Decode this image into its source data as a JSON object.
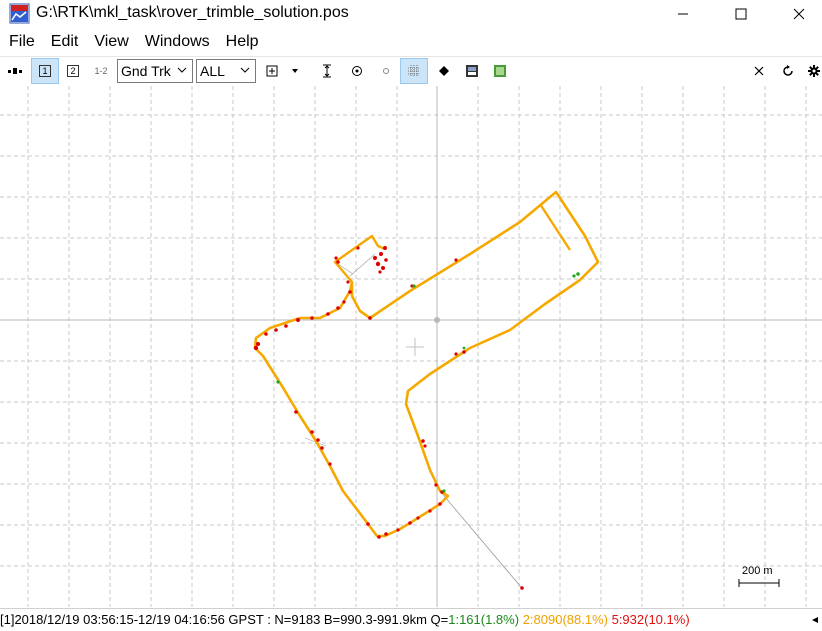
{
  "window": {
    "title": "G:\\RTK\\mkl_task\\rover_trimble_solution.pos",
    "app_icon": "rtkplot-icon",
    "minimize_icon": "minimize-icon",
    "maximize_icon": "maximize-icon",
    "close_icon": "close-icon"
  },
  "menu": {
    "items": [
      "File",
      "Edit",
      "View",
      "Windows",
      "Help"
    ]
  },
  "toolbar": {
    "btn1_label": "1",
    "btn2_label": "2",
    "btn12_label": "1-2",
    "plot_type": "Gnd Trk",
    "quality_filter": "ALL",
    "accent_active": "#cce4f7"
  },
  "plot": {
    "scale_label": "200 m",
    "track_color": "#f5a800",
    "float_color": "#f5a800",
    "single_color": "#e00000",
    "fix_color": "#1fa81f"
  },
  "status": {
    "prefix": "[1]2018/12/19 03:56:15-12/19 04:16:56 GPST : N=9183 B=990.3-991.9km Q=",
    "q1": "1:161(1.8%)",
    "q2": "2:8090(88.1%)",
    "q5": "5:932(10.1%)"
  }
}
